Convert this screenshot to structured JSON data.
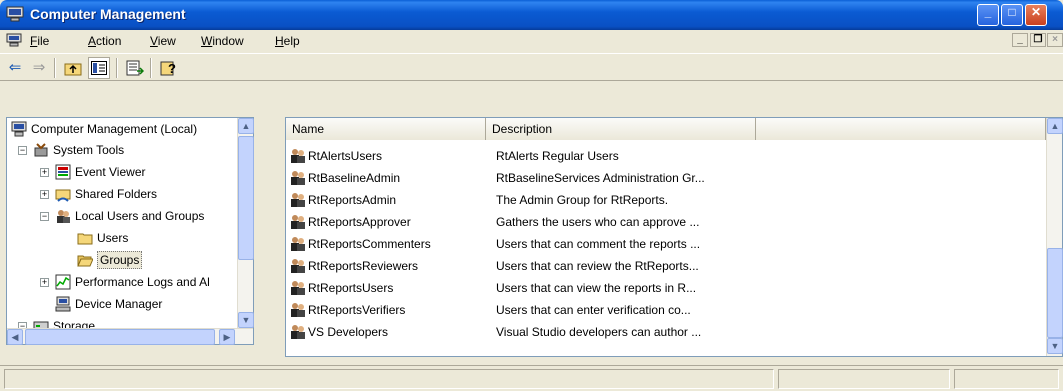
{
  "window": {
    "title": "Computer Management",
    "icon": "computer-icon",
    "controls": [
      "minimize",
      "maximize",
      "close"
    ]
  },
  "menu": {
    "items": [
      {
        "label": "File",
        "accel": "F",
        "rest": "ile"
      },
      {
        "label": "Action",
        "accel": "A",
        "rest": "ction"
      },
      {
        "label": "View",
        "accel": "V",
        "rest": "iew"
      },
      {
        "label": "Window",
        "accel": "W",
        "rest": "indow"
      },
      {
        "label": "Help",
        "accel": "H",
        "rest": "elp"
      }
    ]
  },
  "toolbar": {
    "buttons": [
      "back-arrow-icon",
      "forward-arrow-icon",
      "up-folder-icon",
      "show-hide-tree-icon",
      "export-list-icon",
      "help-icon"
    ]
  },
  "tree": {
    "items": [
      {
        "label": "Computer Management (Local)",
        "icon": "computer-icon",
        "expanded": true
      },
      {
        "label": "System Tools",
        "icon": "tools-icon",
        "expanded": true
      },
      {
        "label": "Event Viewer",
        "icon": "event-viewer-icon",
        "expanded": false
      },
      {
        "label": "Shared Folders",
        "icon": "shared-folder-icon",
        "expanded": false
      },
      {
        "label": "Local Users and Groups",
        "icon": "users-groups-icon",
        "expanded": true
      },
      {
        "label": "Users",
        "icon": "folder-icon"
      },
      {
        "label": "Groups",
        "icon": "folder-open-icon",
        "selected": true
      },
      {
        "label": "Performance Logs and Al",
        "icon": "performance-icon",
        "expanded": false
      },
      {
        "label": "Device Manager",
        "icon": "device-manager-icon"
      },
      {
        "label": "Storage",
        "icon": "storage-icon",
        "expanded": true
      }
    ]
  },
  "list": {
    "columns": [
      "Name",
      "Description"
    ],
    "rows": [
      {
        "name": "RtAlertsUsers",
        "description": "RtAlerts Regular Users"
      },
      {
        "name": "RtBaselineAdmin",
        "description": "RtBaselineServices Administration Gr..."
      },
      {
        "name": "RtReportsAdmin",
        "description": "The Admin Group for RtReports."
      },
      {
        "name": "RtReportsApprover",
        "description": "Gathers the users who can approve ..."
      },
      {
        "name": "RtReportsCommenters",
        "description": "Users that can comment the reports ..."
      },
      {
        "name": "RtReportsReviewers",
        "description": "Users that can review the RtReports..."
      },
      {
        "name": "RtReportsUsers",
        "description": "Users that can view the reports in R..."
      },
      {
        "name": "RtReportsVerifiers",
        "description": "Users that can enter verification co..."
      },
      {
        "name": "VS Developers",
        "description": "Visual Studio developers can author ..."
      }
    ]
  },
  "colors": {
    "titlebar": "#0b5bd3",
    "selection_bg": "#ece9d8"
  }
}
